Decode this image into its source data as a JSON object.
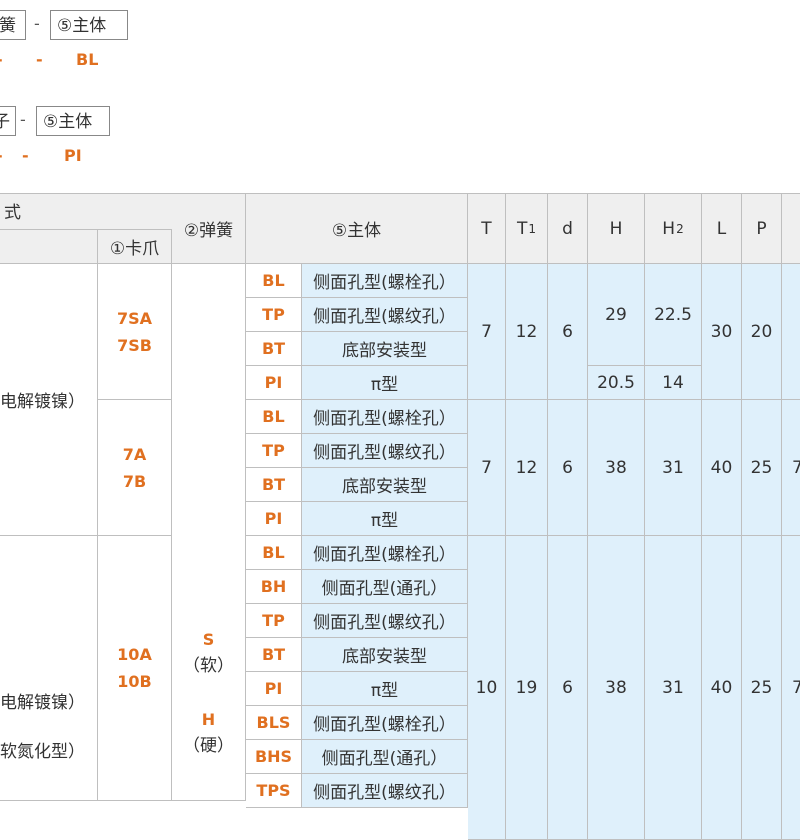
{
  "top": {
    "row1": {
      "box_left": "簧",
      "sep": "-",
      "box_right": "⑤主体",
      "dash1": "-",
      "dash2": "-",
      "code": "BL"
    },
    "row2": {
      "box_left": "子",
      "sep": "-",
      "box_right": "⑤主体",
      "dash1": "-",
      "dash2": "-",
      "code": "PI"
    }
  },
  "table": {
    "headers": {
      "method": "式",
      "clamp": "①卡爪",
      "spring": "②弹簧",
      "body": "⑤主体",
      "T": "T",
      "T1_main": "T",
      "T1_sub": "1",
      "d": "d",
      "H": "H",
      "H2_main": "H",
      "H2_sub": "2",
      "L": "L",
      "P": "P"
    },
    "left_labels": {
      "g1": "电解镀镍）",
      "g3a": "电解镀镍）",
      "g3b": "软氮化型）"
    },
    "clamps": {
      "g1a": "7SA",
      "g1b": "7SB",
      "g2a": "7A",
      "g2b": "7B",
      "g3a": "10A",
      "g3b": "10B"
    },
    "springs": {
      "s_code": "S",
      "s_label": "（软）",
      "h_code": "H",
      "h_label": "（硬）"
    },
    "rows": [
      {
        "code": "BL",
        "desc": "侧面孔型(螺栓孔）"
      },
      {
        "code": "TP",
        "desc": "侧面孔型(螺纹孔）"
      },
      {
        "code": "BT",
        "desc": "底部安装型"
      },
      {
        "code": "PI",
        "desc": "π型"
      },
      {
        "code": "BL",
        "desc": "侧面孔型(螺栓孔）"
      },
      {
        "code": "TP",
        "desc": "侧面孔型(螺纹孔）"
      },
      {
        "code": "BT",
        "desc": "底部安装型"
      },
      {
        "code": "PI",
        "desc": "π型"
      },
      {
        "code": "BL",
        "desc": "侧面孔型(螺栓孔）"
      },
      {
        "code": "BH",
        "desc": "侧面孔型(通孔）"
      },
      {
        "code": "TP",
        "desc": "侧面孔型(螺纹孔）"
      },
      {
        "code": "BT",
        "desc": "底部安装型"
      },
      {
        "code": "PI",
        "desc": "π型"
      },
      {
        "code": "BLS",
        "desc": "侧面孔型(螺栓孔）"
      },
      {
        "code": "BHS",
        "desc": "侧面孔型(通孔）"
      },
      {
        "code": "TPS",
        "desc": "侧面孔型(螺纹孔）"
      }
    ],
    "groups": {
      "g1": {
        "T": "7",
        "T1": "12",
        "d": "6",
        "H_a": "29",
        "H2_a": "22.5",
        "H_b": "20.5",
        "H2_b": "14",
        "L": "30",
        "P": "20"
      },
      "g2": {
        "T": "7",
        "T1": "12",
        "d": "6",
        "H": "38",
        "H2": "31",
        "L": "40",
        "P": "25",
        "extra": "7"
      },
      "g3": {
        "T": "10",
        "T1": "19",
        "d": "6",
        "H": "38",
        "H2": "31",
        "L": "40",
        "P": "25",
        "extra": "7"
      }
    }
  }
}
